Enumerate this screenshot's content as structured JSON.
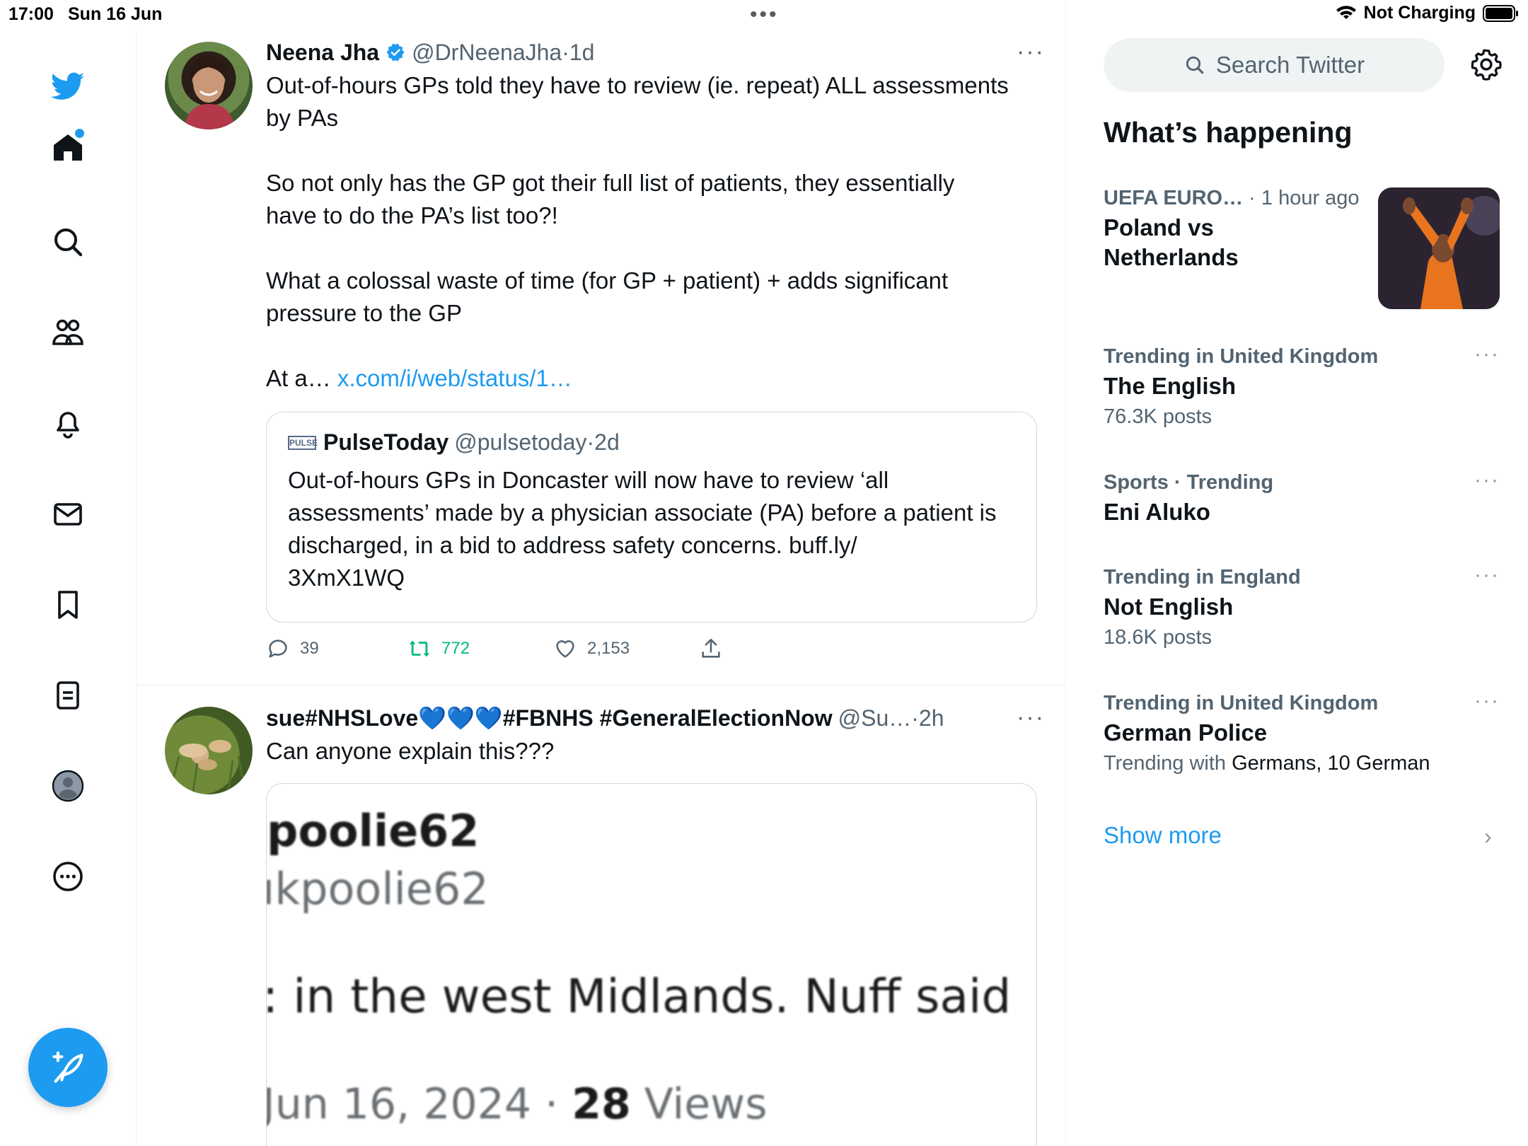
{
  "status_bar": {
    "time": "17:00",
    "date": "Sun 16 Jun",
    "multitask": "•••",
    "charging": "Not Charging"
  },
  "nav": {
    "items": [
      "twitter-logo",
      "home",
      "explore",
      "communities",
      "notifications",
      "messages",
      "bookmarks",
      "lists",
      "profile",
      "more"
    ],
    "compose_icon": "compose-feather-icon"
  },
  "tweets": [
    {
      "name": "Neena Jha",
      "verified": true,
      "handle": "@DrNeenaJha",
      "sep": " · ",
      "time": "1d",
      "more": "···",
      "text": "Out-of-hours GPs told they have to review (ie. repeat) ALL assessments\nby PAs\n\nSo not only has the GP got their full list of patients, they essentially\nhave to do the PA’s list too?!\n\nWhat a colossal waste of time (for GP + patient) + adds significant\npressure to the GP\n\nAt a… ",
      "link": "x.com/i/web/status/1…",
      "quote": {
        "logo": "PULSE",
        "name": "PulseToday",
        "handle": "@pulsetoday",
        "sep": " · ",
        "time": "2d",
        "text": "Out-of-hours GPs in Doncaster will now have to review ‘all assessments’ made by a physician associate (PA) before a patient is discharged, in a bid to address safety concerns. buff.ly/\n3XmX1WQ"
      },
      "replies": "39",
      "retweets": "772",
      "likes": "2,153"
    },
    {
      "name": "sue#NHSLove💙💙💙#FBNHS #GeneralElectionNow",
      "verified": false,
      "handle": "@Su…",
      "sep": " · ",
      "time": "2h",
      "more": "···",
      "text": "Can anyone explain this???",
      "media_lines": [
        "poolie62",
        "ıkpoolie62",
        ": in the west Midlands.  Nuff said",
        "Jun 16, 2024 · ",
        "28",
        " Views"
      ]
    }
  ],
  "sidebar": {
    "search_placeholder": "Search Twitter",
    "section_title": "What’s happening",
    "trends": [
      {
        "meta_bold": "UEFA EURO…",
        "meta_rest": " · 1 hour ago",
        "topic": "Poland vs\nNetherlands",
        "count": "",
        "has_image": true
      },
      {
        "meta_bold": "Trending in United Kingdom",
        "meta_rest": "",
        "topic": "The English",
        "count": "76.3K posts"
      },
      {
        "meta_bold": "Sports · Trending",
        "meta_rest": "",
        "topic": "Eni Aluko",
        "count": ""
      },
      {
        "meta_bold": "Trending in England",
        "meta_rest": "",
        "topic": "Not English",
        "count": "18.6K posts"
      },
      {
        "meta_bold": "Trending in United Kingdom",
        "meta_rest": "",
        "topic": "German Police",
        "count_prefix": "Trending with ",
        "count_dark": "Germans, 10 German"
      }
    ],
    "show_more": "Show more",
    "more": "···",
    "chevron": "›"
  },
  "colors": {
    "accent": "#1d9bf0",
    "retweet": "#00ba7c",
    "muted": "#536471"
  }
}
